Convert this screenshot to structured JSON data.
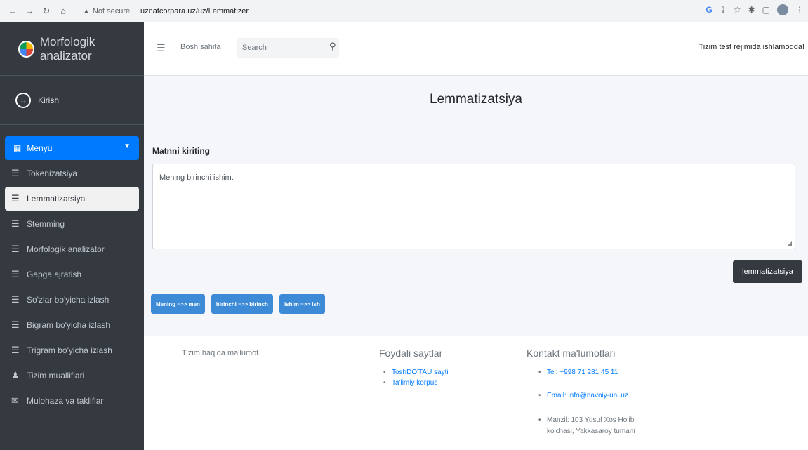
{
  "browser": {
    "security_label": "Not secure",
    "url": "uznatcorpara.uz/uz/Lemmatizer"
  },
  "sidebar": {
    "brand": "Morfologik analizator",
    "login_label": "Kirish",
    "menu_label": "Menyu",
    "items": [
      {
        "label": "Tokenizatsiya",
        "icon": "list-icon"
      },
      {
        "label": "Lemmatizatsiya",
        "icon": "list-icon"
      },
      {
        "label": "Stemming",
        "icon": "list-icon"
      },
      {
        "label": "Morfologik analizator",
        "icon": "list-icon"
      },
      {
        "label": "Gapga ajratish",
        "icon": "list-icon"
      },
      {
        "label": "So'zlar bo'yicha izlash",
        "icon": "list-icon"
      },
      {
        "label": "Bigram bo'yicha izlash",
        "icon": "list-icon"
      },
      {
        "label": "Trigram bo'yicha izlash",
        "icon": "list-icon"
      },
      {
        "label": "Tizim mualliflari",
        "icon": "user-icon"
      },
      {
        "label": "Mulohaza va takliflar",
        "icon": "comments-icon"
      }
    ],
    "active_item": "Lemmatizatsiya"
  },
  "topnav": {
    "home": "Bosh sahifa",
    "search_placeholder": "Search",
    "status": "Tizim test rejimida ishlamoqda!"
  },
  "main": {
    "title": "Lemmatizatsiya",
    "input_label": "Matnni kiriting",
    "input_value": "Mening birinchi ishim.",
    "submit_label": "lemmatizatsiya",
    "results": [
      "Mening =>> men",
      "birinchi =>> birinch",
      "ishim =>> ish"
    ]
  },
  "footer": {
    "about": "Tizim haqida ma'lumot.",
    "links_title": "Foydali saytlar",
    "links": [
      "ToshDO'TAU sayti",
      "Ta'limiy korpus"
    ],
    "contacts_title": "Kontakt ma'lumotlari",
    "phone": "Tel: +998 71 281 45 11",
    "email": "Email: info@navoiy-uni.uz",
    "address": "Manzil: 103 Yusuf Xos Hojib ko'chasi, Yakkasaroy tumani"
  },
  "colors": {
    "sidebar_bg": "#343a40",
    "accent": "#007bff",
    "result_tag": "#3d8bd6",
    "button_dark": "#343a40"
  }
}
